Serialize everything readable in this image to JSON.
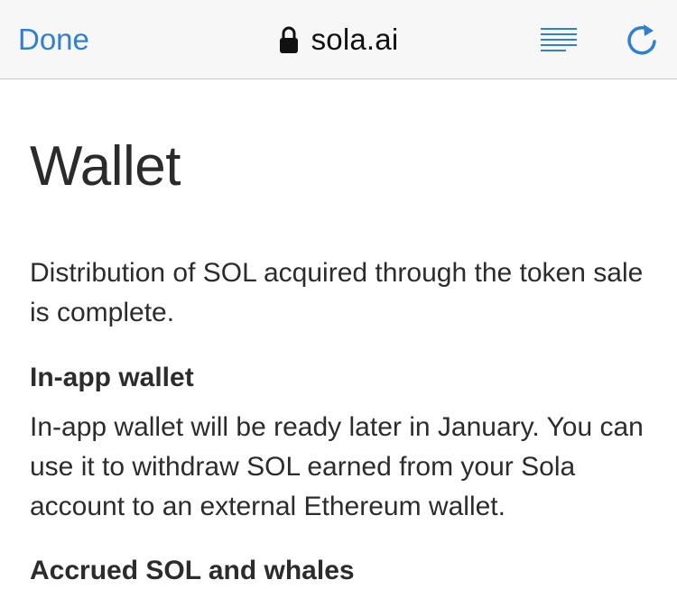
{
  "browser": {
    "done_label": "Done",
    "url": "sola.ai",
    "accent_color": "#2f7fd4",
    "icons": {
      "lock": "lock-icon",
      "reader": "reader-mode-icon",
      "reload": "reload-icon"
    }
  },
  "page": {
    "title": "Wallet",
    "intro": "Distribution of SOL acquired through the token sale is complete.",
    "sections": [
      {
        "heading": "In-app wallet",
        "body": "In-app wallet will be ready later in January. You can use it to withdraw SOL earned from your Sola account to an external Ethereum wallet."
      }
    ],
    "next_heading_partial": "Accrued SOL and whales"
  }
}
